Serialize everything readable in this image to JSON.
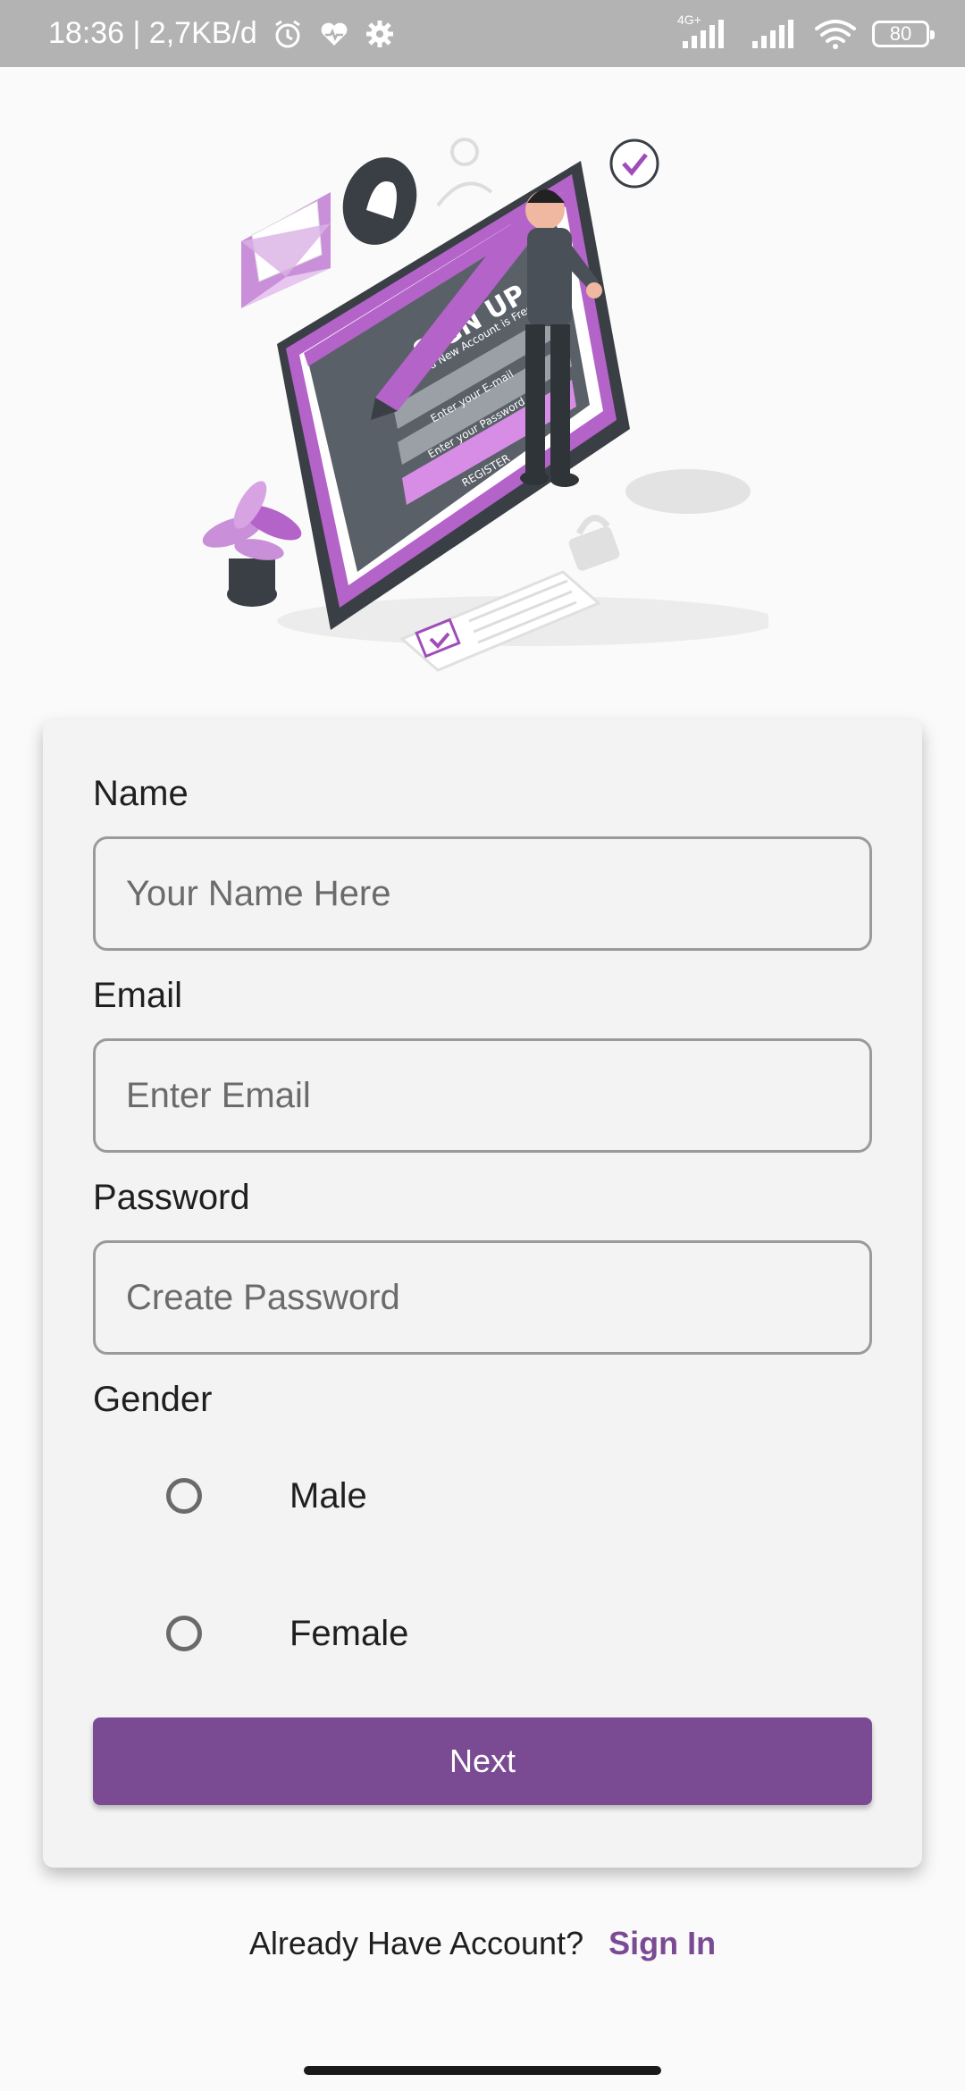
{
  "status_bar": {
    "time_speed": "18:36 | 2,7KB/d",
    "network_label": "4G+",
    "battery": "80",
    "icons": [
      "alarm-icon",
      "heart-icon",
      "gear-icon",
      "signal-icon",
      "signal-icon",
      "wifi-icon",
      "battery-icon"
    ]
  },
  "illustration": {
    "heading": "SIGN UP",
    "subheading": "Create a New Account is Free",
    "field1": "Enter your E-mail",
    "field2": "Enter your Password",
    "button": "REGISTER"
  },
  "form": {
    "name_label": "Name",
    "name_placeholder": "Your Name Here",
    "email_label": "Email",
    "email_placeholder": "Enter Email",
    "password_label": "Password",
    "password_placeholder": "Create Password",
    "gender_label": "Gender",
    "gender_options": [
      "Male",
      "Female"
    ],
    "next_label": "Next"
  },
  "footer": {
    "prompt": "Already Have Account?",
    "signin_label": "Sign In"
  },
  "colors": {
    "accent": "#7a4a93",
    "status_bar": "#b3b3b3",
    "card": "#f3f3f3",
    "illustration_purple": "#b463c9"
  }
}
